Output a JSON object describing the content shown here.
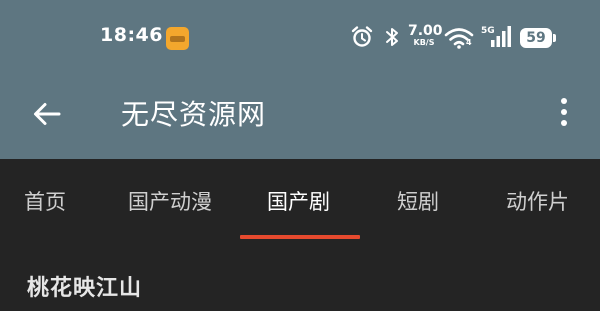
{
  "status_bar": {
    "time": "18:46",
    "net_speed_value": "7.00",
    "net_speed_unit": "KB/S",
    "network_type": "5G",
    "wifi_badge": "4",
    "battery_level": "59"
  },
  "toolbar": {
    "title": "无尽资源网"
  },
  "tabs": [
    {
      "label": "首页"
    },
    {
      "label": "国产动漫"
    },
    {
      "label": "国产剧"
    },
    {
      "label": "短剧"
    },
    {
      "label": "动作片"
    }
  ],
  "active_tab_index": 2,
  "content": {
    "item_title": "桃花映江山"
  },
  "colors": {
    "app_bar": "#5e7681",
    "background": "#242424",
    "accent": "#e64a2e"
  },
  "icons": [
    "back-arrow-icon",
    "more-vert-icon",
    "alarm-icon",
    "bluetooth-icon",
    "wifi-icon",
    "signal-icon",
    "battery-icon"
  ]
}
